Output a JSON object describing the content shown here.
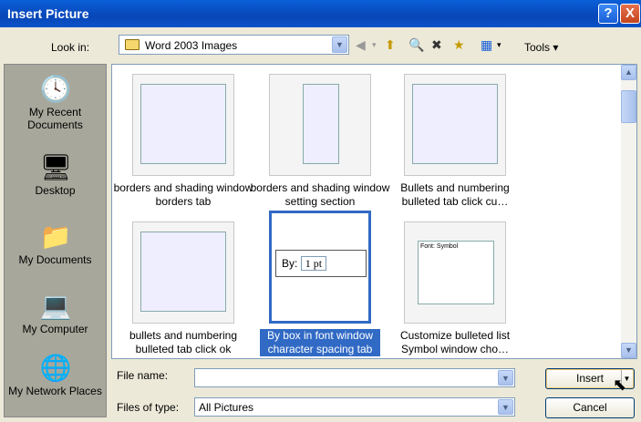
{
  "window": {
    "title": "Insert Picture",
    "help": "?",
    "close": "X"
  },
  "toolbar": {
    "look_in_label": "Look in:",
    "look_in_value": "Word 2003 Images",
    "tools_label": "Tools"
  },
  "places": [
    {
      "label": "My Recent Documents",
      "icon": "recent-documents-icon"
    },
    {
      "label": "Desktop",
      "icon": "desktop-icon"
    },
    {
      "label": "My Documents",
      "icon": "my-documents-icon"
    },
    {
      "label": "My Computer",
      "icon": "my-computer-icon"
    },
    {
      "label": "My Network Places",
      "icon": "network-places-icon"
    }
  ],
  "files": [
    {
      "caption": "borders and shading window borders tab",
      "selected": false
    },
    {
      "caption": "borders and shading window setting section",
      "selected": false
    },
    {
      "caption": "Bullets and numbering bulleted tab click cu…",
      "selected": false
    },
    {
      "caption": "bullets and numbering bulleted tab click ok",
      "selected": false
    },
    {
      "caption": "By box in font window character spacing tab",
      "selected": true
    },
    {
      "caption": "Customize bulleted list Symbol window cho…",
      "selected": false
    }
  ],
  "thumb_text": {
    "by_label": "By:",
    "by_value": "1 pt",
    "font_label": "Font:",
    "font_value": "Symbol"
  },
  "form": {
    "file_name_label": "File name:",
    "file_name_value": "",
    "files_of_type_label": "Files of type:",
    "files_of_type_value": "All Pictures"
  },
  "buttons": {
    "insert": "Insert",
    "cancel": "Cancel"
  },
  "colors": {
    "titlebar": "#0a52c8",
    "selection": "#316ac5",
    "dialog": "#ece9d8"
  }
}
